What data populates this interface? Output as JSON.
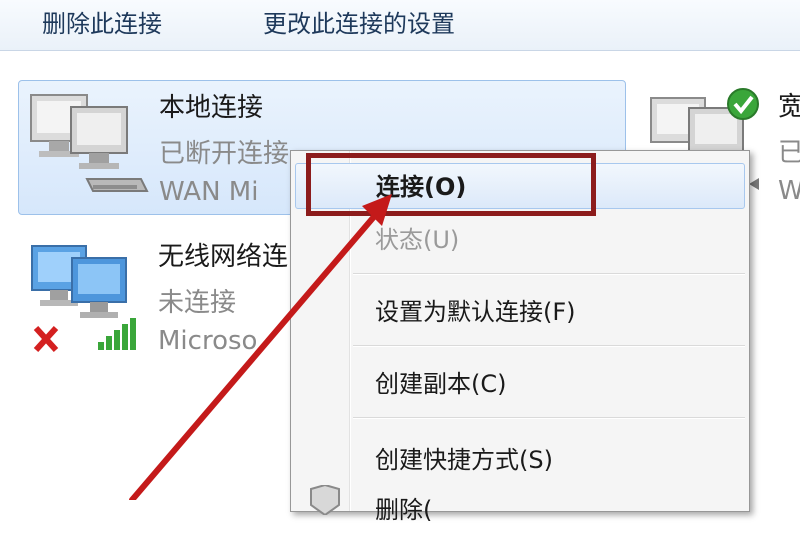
{
  "toolbar": {
    "delete_label": "删除此连接",
    "change_label": "更改此连接的设置"
  },
  "connections": [
    {
      "name": "本地连接",
      "status": "已断开连接",
      "device": "WAN Mi"
    },
    {
      "name": "无线网络连",
      "status": "未连接",
      "device": "Microso"
    },
    {
      "name": "宽",
      "status": "已",
      "device": "W"
    }
  ],
  "context_menu": {
    "items": [
      {
        "label": "连接(O)",
        "bold": true,
        "highlighted": true
      },
      {
        "label": "状态(U)",
        "disabled": true
      },
      {
        "label": "设置为默认连接(F)"
      },
      {
        "label": "创建副本(C)"
      },
      {
        "label": "创建快捷方式(S)"
      },
      {
        "label": "删除("
      }
    ]
  },
  "colors": {
    "selection_border": "#9dc1ea",
    "annotation_red": "#c41a1a",
    "highlight_box": "#8c1c1c",
    "success_green": "#3aa63a"
  },
  "icons": [
    "network-computer-icon",
    "network-cable-icon",
    "error-x-icon",
    "signal-bars-icon",
    "check-icon"
  ]
}
